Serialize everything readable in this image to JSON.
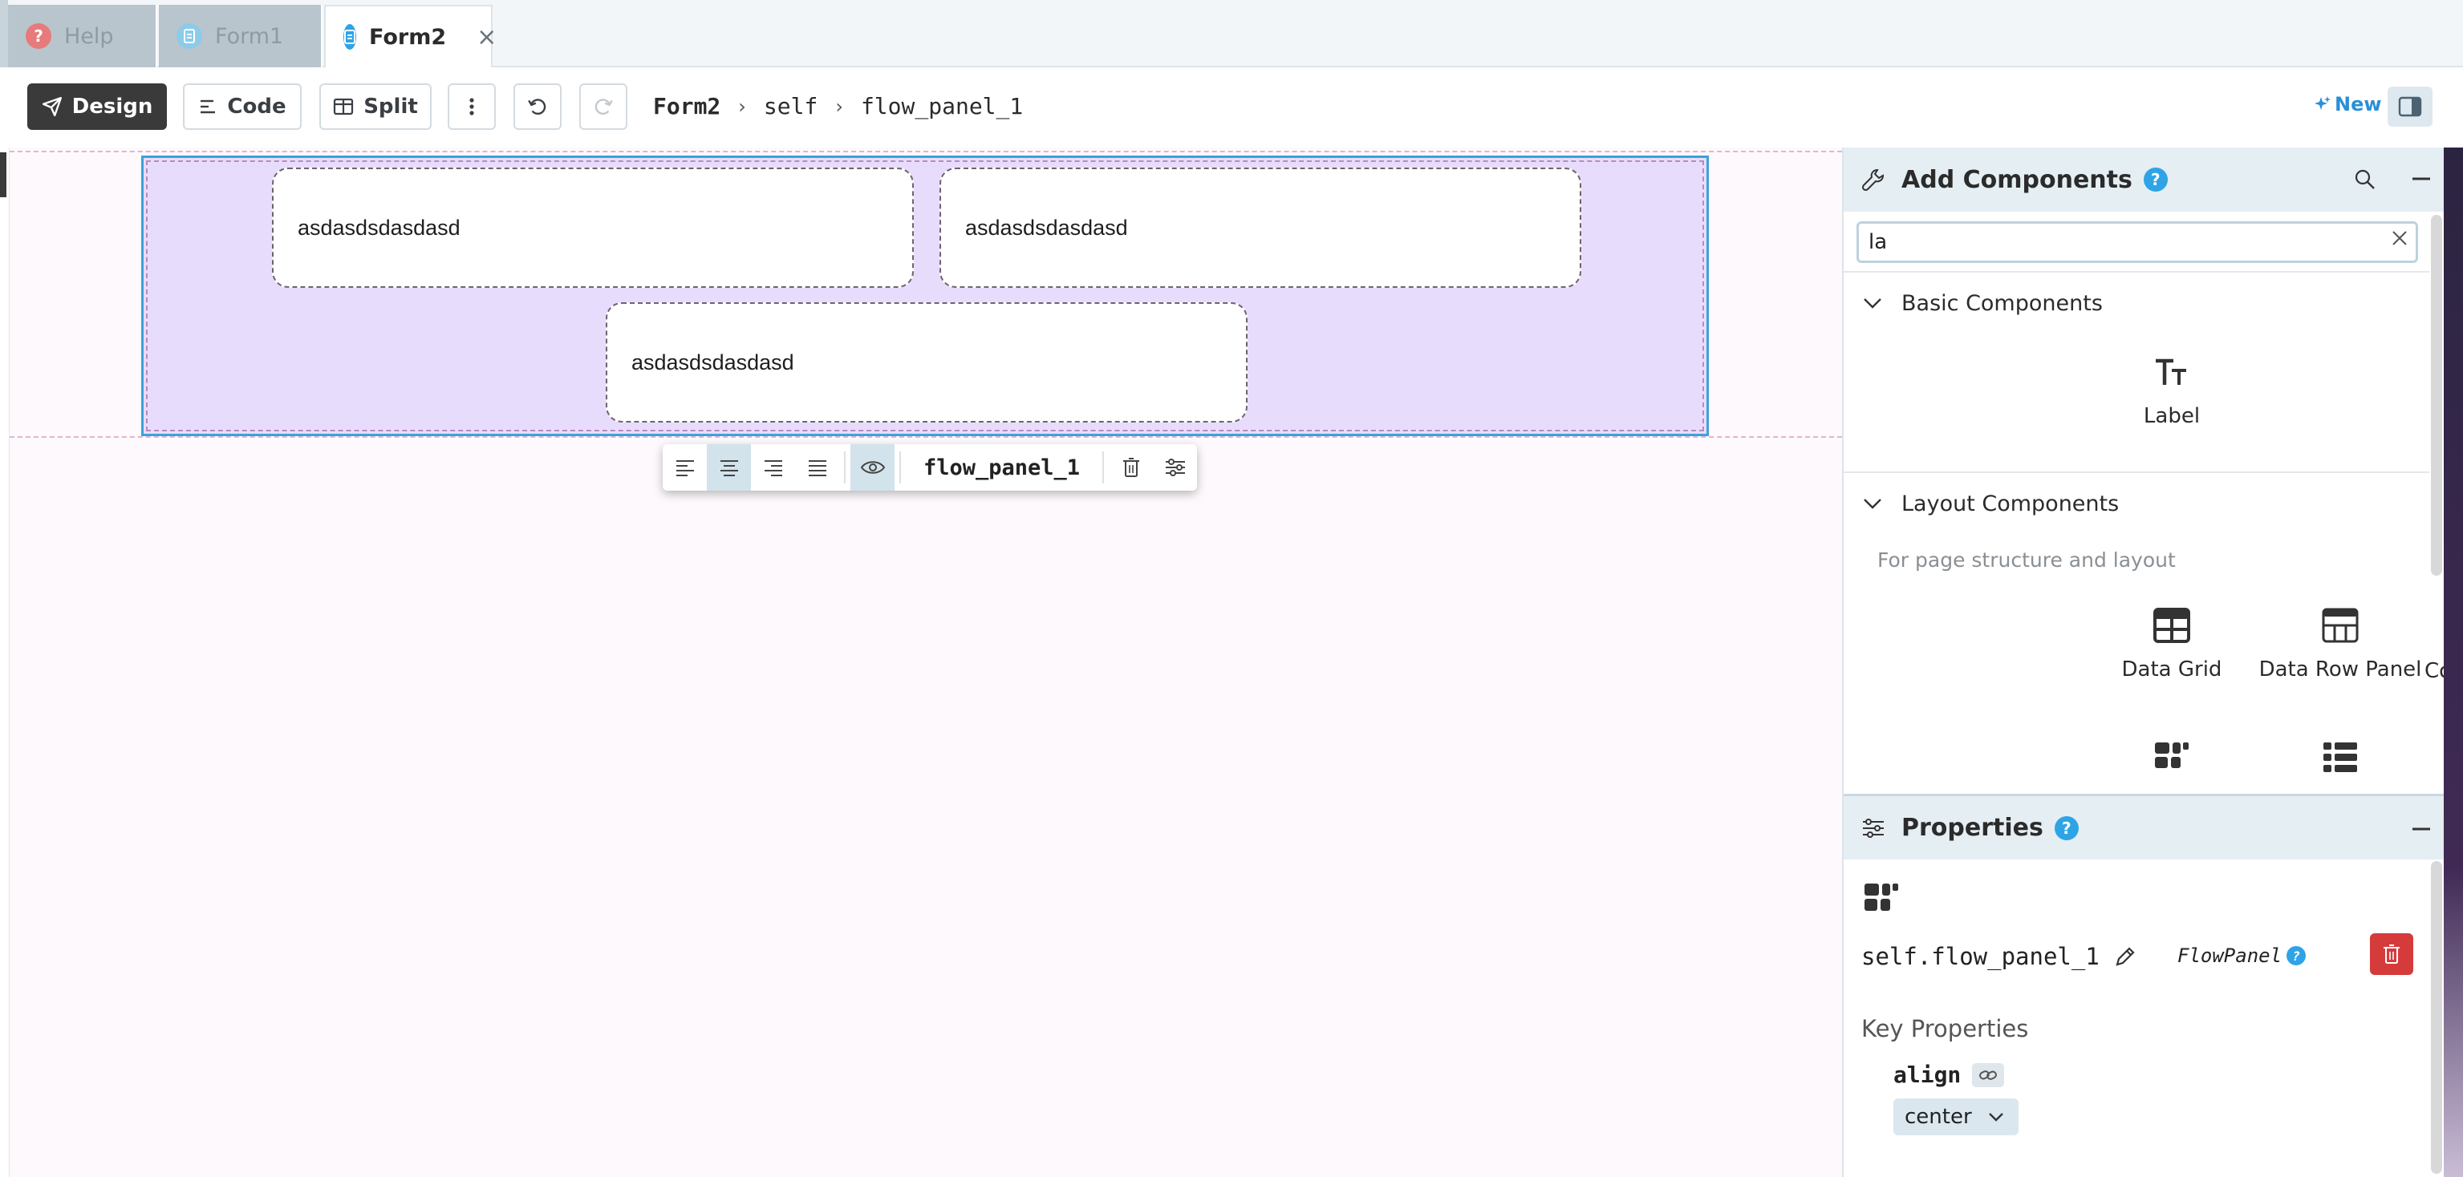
{
  "tabs": [
    {
      "label": "Help",
      "icon": "help-icon",
      "color": "#e77a7a",
      "active": false
    },
    {
      "label": "Form1",
      "icon": "form-icon",
      "color": "#8ccbe9",
      "active": false
    },
    {
      "label": "Form2",
      "icon": "form-icon",
      "color": "#2ea4e6",
      "active": true
    }
  ],
  "toolbar": {
    "design_label": "Design",
    "code_label": "Code",
    "split_label": "Split",
    "new_label": "New"
  },
  "breadcrumb": [
    "Form2",
    "self",
    "flow_panel_1"
  ],
  "canvas": {
    "textboxes": [
      "asdasdsdasdasd",
      "asdasdsdasdasd",
      "asdasdsdasdasd"
    ],
    "selected_component": "flow_panel_1"
  },
  "add_components": {
    "title": "Add Components",
    "search_value": "la",
    "basic_section": "Basic Components",
    "basic_items": [
      {
        "label": "Label",
        "icon": "label-icon"
      }
    ],
    "layout_section": "Layout Components",
    "layout_description": "For page structure and layout",
    "layout_items": [
      {
        "label": "Data Grid",
        "icon": "data-grid-icon"
      },
      {
        "label": "Data Row Panel",
        "icon": "data-row-panel-icon"
      },
      {
        "label": "Column Panel",
        "icon": "column-panel-icon"
      }
    ]
  },
  "properties": {
    "title": "Properties",
    "component_name": "self.flow_panel_1",
    "component_type": "FlowPanel",
    "key_properties_label": "Key Properties",
    "align_label": "align",
    "align_value": "center"
  },
  "colors": {
    "accent": "#2ea4e6",
    "selection_border": "#3da2d8",
    "flow_panel_bg": "#e8dcfc",
    "delete_red": "#d63b3b"
  }
}
